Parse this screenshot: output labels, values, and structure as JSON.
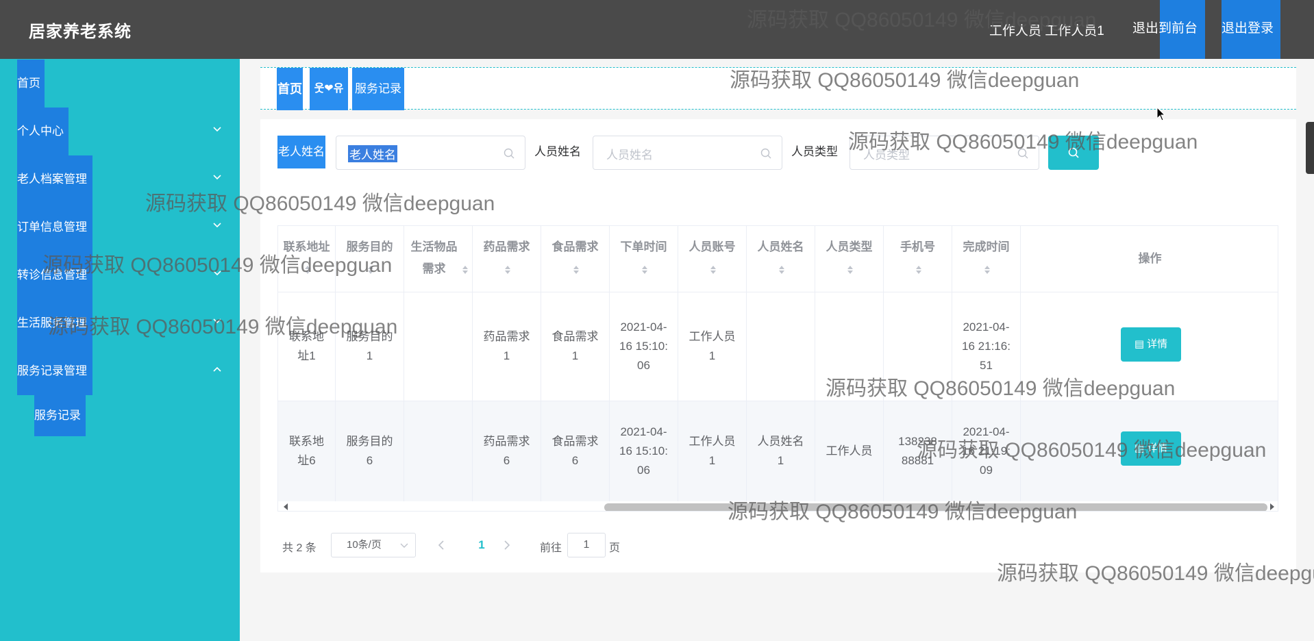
{
  "header": {
    "app_title": "居家养老系统",
    "user_info": "工作人员 工作人员1",
    "btn_front": "退出到前台",
    "btn_logout": "退出登录"
  },
  "sidebar": {
    "items": [
      {
        "label": "首页"
      },
      {
        "label": "个人中心"
      },
      {
        "label": "老人档案管理"
      },
      {
        "label": "订单信息管理"
      },
      {
        "label": "转诊信息管理"
      },
      {
        "label": "生活服务管理"
      },
      {
        "label": "服务记录管理"
      }
    ],
    "sub_item": "服务记录"
  },
  "breadcrumb": {
    "home": "首页",
    "separator": "웃❤유",
    "current": "服务记录"
  },
  "search": {
    "elder_label": "老人姓名",
    "elder_placeholder": "老人姓名",
    "staff_name_label": "人员姓名",
    "staff_name_placeholder": "人员姓名",
    "staff_type_label": "人员类型",
    "staff_type_placeholder": "人员类型"
  },
  "table": {
    "headers": [
      "联系地址",
      "服务目的",
      "生活物品需求",
      "药品需求",
      "食品需求",
      "下单时间",
      "人员账号",
      "人员姓名",
      "人员类型",
      "手机号",
      "完成时间",
      "操作"
    ],
    "rows": [
      {
        "address": "联系地址1",
        "purpose": "服务目的1",
        "goods": "",
        "medicine": "药品需求1",
        "food": "食品需求1",
        "order_time": "2021-04-16 15:10:06",
        "account": "工作人员1",
        "name": "",
        "type": "",
        "phone": "",
        "finish_time": "2021-04-16 21:16:51",
        "action": "详情"
      },
      {
        "address": "联系地址6",
        "purpose": "服务目的6",
        "goods": "",
        "medicine": "药品需求6",
        "food": "食品需求6",
        "order_time": "2021-04-16 15:10:06",
        "account": "工作人员1",
        "name": "人员姓名1",
        "type": "工作人员",
        "phone": "13823888881",
        "finish_time": "2021-04-16 21:19:09",
        "action": "详情"
      }
    ]
  },
  "pagination": {
    "total": "共 2 条",
    "page_size": "10条/页",
    "current_page": "1",
    "goto_prefix": "前往",
    "goto_value": "1",
    "goto_suffix": "页"
  },
  "watermark": "源码获取 QQ86050149 微信deepguan",
  "colors": {
    "header_bg": "#4a4a4a",
    "sidebar_bg": "#22bfcc",
    "accent_blue": "#1e7fe0",
    "teal_button": "#22bfcc"
  }
}
